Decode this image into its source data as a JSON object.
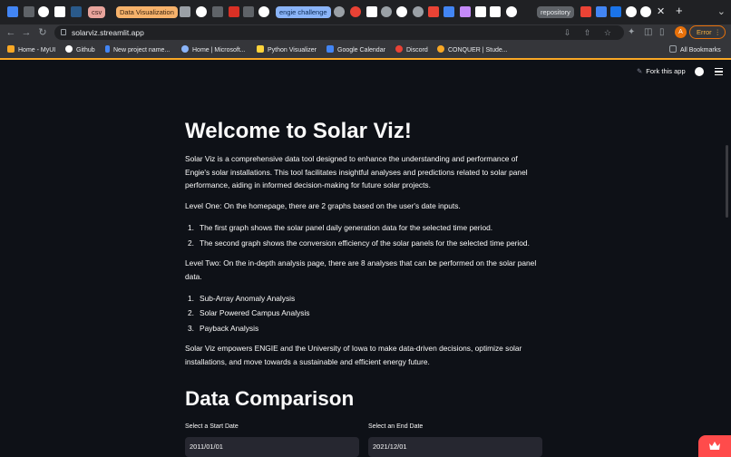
{
  "browser": {
    "tab_pills": {
      "csv": "csv",
      "data_viz": "Data Visualization",
      "engie": "engie challenge",
      "repository": "repository"
    },
    "url": "solarviz.streamlit.app",
    "error_label": "Error",
    "profile_initial": "A",
    "bookmarks": [
      "Home - MyUI",
      "Github",
      "New project name...",
      "Home | Microsoft...",
      "Python Visualizer",
      "Google Calendar",
      "Discord",
      "CONQUER | Stude..."
    ],
    "all_bookmarks": "All Bookmarks"
  },
  "header": {
    "fork_label": "Fork this app"
  },
  "main": {
    "title": "Welcome to Solar Viz!",
    "intro": "Solar Viz is a comprehensive data tool designed to enhance the understanding and performance of Engie's solar installations. This tool facilitates insightful analyses and predictions related to solar panel performance, aiding in informed decision-making for future solar projects.",
    "level_one": "Level One: On the homepage, there are 2 graphs based on the user's date inputs.",
    "level_one_items": [
      "The first graph shows the solar panel daily generation data for the selected time period.",
      "The second graph shows the conversion efficiency of the solar panels for the selected time period."
    ],
    "level_two": "Level Two: On the in-depth analysis page, there are 8 analyses that can be performed on the solar panel data.",
    "level_two_items": [
      "Sub-Array Anomaly Analysis",
      "Solar Powered Campus Analysis",
      "Payback Analysis"
    ],
    "closing": "Solar Viz empowers ENGIE and the University of Iowa to make data-driven decisions, optimize solar installations, and move towards a sustainable and efficient energy future.",
    "section_title": "Data Comparison",
    "start_label": "Select a Start Date",
    "start_value": "2011/01/01",
    "end_label": "Select an End Date",
    "end_value": "2021/12/01"
  },
  "colors": {
    "background": "#0e1117",
    "accent": "#ff4b4b",
    "input_bg": "#262730"
  }
}
